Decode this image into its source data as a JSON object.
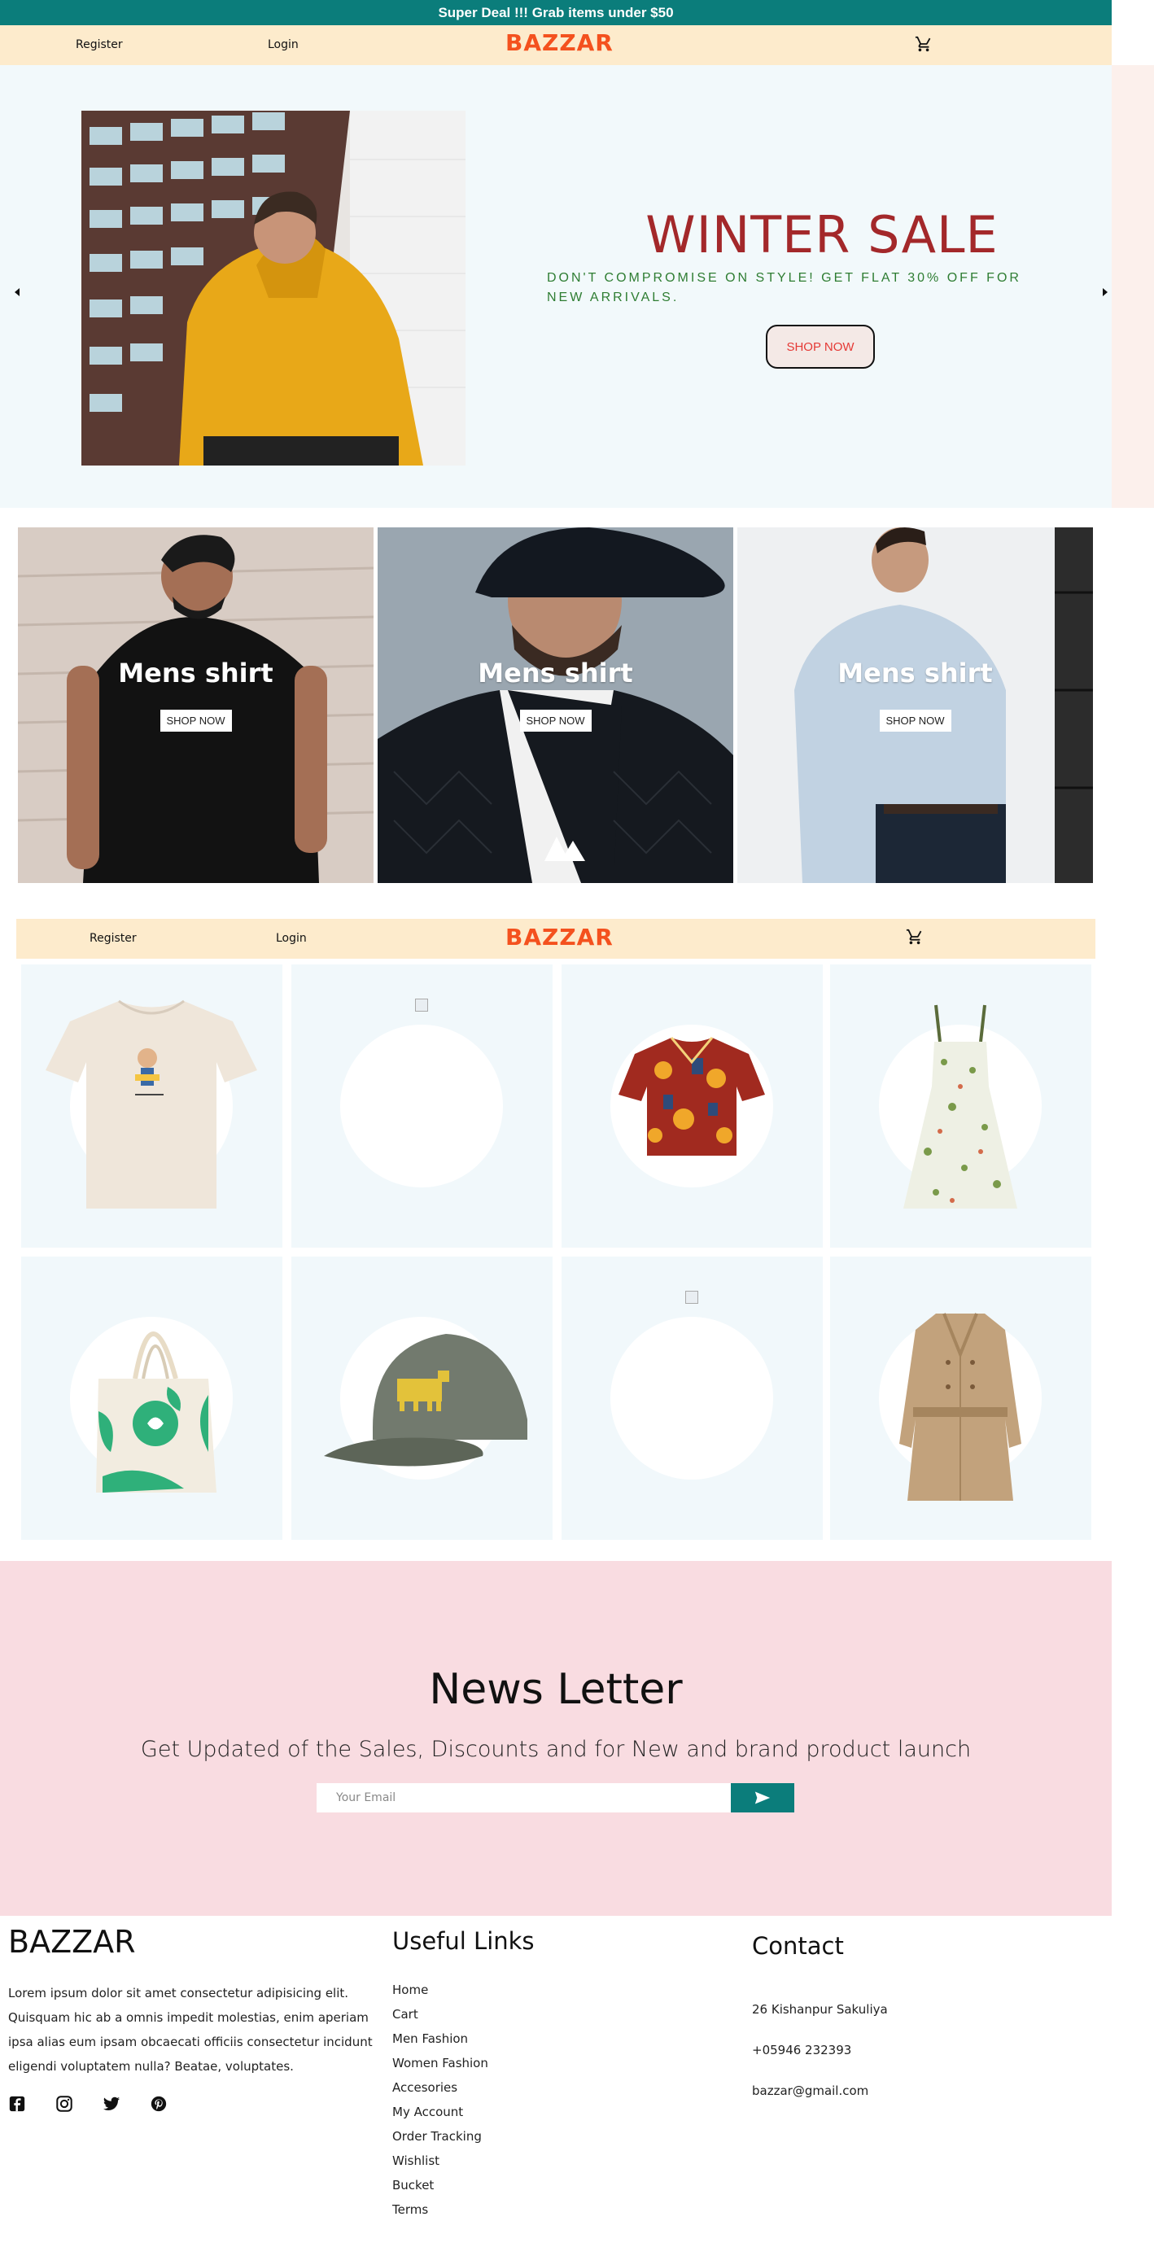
{
  "promo": {
    "text": "Super Deal !!! Grab items under $50"
  },
  "header": {
    "register_label": "Register",
    "login_label": "Login",
    "brand": "BAZZAR",
    "cart_icon": "cart-icon"
  },
  "hero": {
    "title": "WINTER SALE",
    "subtitle": "DON'T COMPROMISE ON STYLE! GET FLAT 30% OFF FOR NEW ARRIVALS.",
    "button_label": "SHOP NOW",
    "prev_icon": "arrow-left-icon",
    "next_icon": "arrow-right-icon"
  },
  "categories": [
    {
      "title": "Mens shirt",
      "button_label": "SHOP NOW"
    },
    {
      "title": "Mens shirt",
      "button_label": "SHOP NOW"
    },
    {
      "title": "Mens shirt",
      "button_label": "SHOP NOW"
    }
  ],
  "header2": {
    "register_label": "Register",
    "login_label": "Login",
    "brand": "BAZZAR",
    "cart_icon": "cart-icon"
  },
  "newsletter": {
    "title": "News Letter",
    "subtitle": "Get Updated of the Sales, Discounts and for New and brand product launch",
    "email_placeholder": "Your Email",
    "send_icon": "send-icon"
  },
  "footer": {
    "brand": "BAZZAR",
    "about": "Lorem ipsum dolor sit amet consectetur adipisicing elit. Quisquam hic ab a omnis impedit molestias, enim aperiam ipsa alias eum ipsam obcaecati officiis consectetur incidunt eligendi voluptatem nulla? Beatae, voluptates.",
    "social_icons": [
      "facebook-icon",
      "instagram-icon",
      "twitter-icon",
      "pinterest-icon"
    ],
    "links_heading": "Useful Links",
    "links": [
      "Home",
      "Cart",
      "Men Fashion",
      "Women Fashion",
      "Accesories",
      "My Account",
      "Order Tracking",
      "Wishlist",
      "Bucket",
      "Terms"
    ],
    "contact_heading": "Contact",
    "address": "26 Kishanpur Sakuliya",
    "phone": "+05946 232393",
    "email": "bazzar@gmail.com"
  },
  "colors": {
    "promo_bg": "#0b7d7b",
    "nav_bg": "#fdebcc",
    "brand": "#f4511e",
    "hero_title": "#a3282a",
    "hero_subtitle": "#2e7d32",
    "newsletter_bg": "#f9dce1"
  }
}
